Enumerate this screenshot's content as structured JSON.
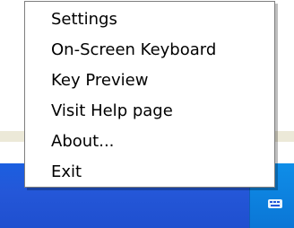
{
  "menu": {
    "items": [
      {
        "label": "Settings"
      },
      {
        "label": "On-Screen Keyboard"
      },
      {
        "label": "Key Preview"
      },
      {
        "label": "Visit Help page"
      },
      {
        "label": "About..."
      },
      {
        "label": "Exit"
      }
    ]
  },
  "colors": {
    "menu_background": "#ffffff",
    "menu_border": "#7f7f7f",
    "taskbar": "#2457d8",
    "tray": "#0f8ee8"
  },
  "icons": {
    "tray_icon": "keyboard-icon"
  }
}
